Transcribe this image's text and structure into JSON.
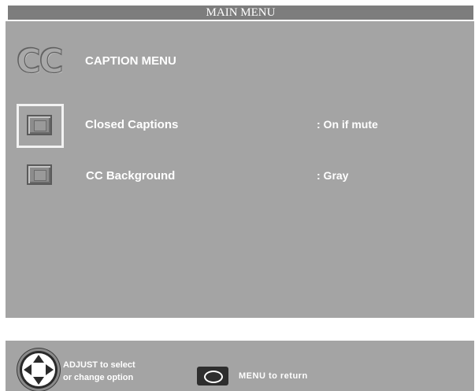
{
  "header": {
    "title": "MAIN MENU"
  },
  "caption_menu": {
    "logo_text": "CC",
    "title": "CAPTION MENU",
    "options": [
      {
        "label": "Closed Captions",
        "value": ":  On if mute",
        "selected": true
      },
      {
        "label": "CC Background",
        "value": ":  Gray",
        "selected": false
      }
    ]
  },
  "footer": {
    "adjust_line1": "ADJUST to select",
    "adjust_line2": "or change option",
    "menu_hint": "MENU  to  return"
  },
  "icons": {
    "dpad": "dpad-icon",
    "menu": "menu-oval-icon",
    "option": "option-square-icon"
  },
  "colors": {
    "panel": "#a4a4a4",
    "title_bar": "#7d7d7d",
    "text": "#ffffff",
    "selection_border": "#f2f2f2"
  }
}
